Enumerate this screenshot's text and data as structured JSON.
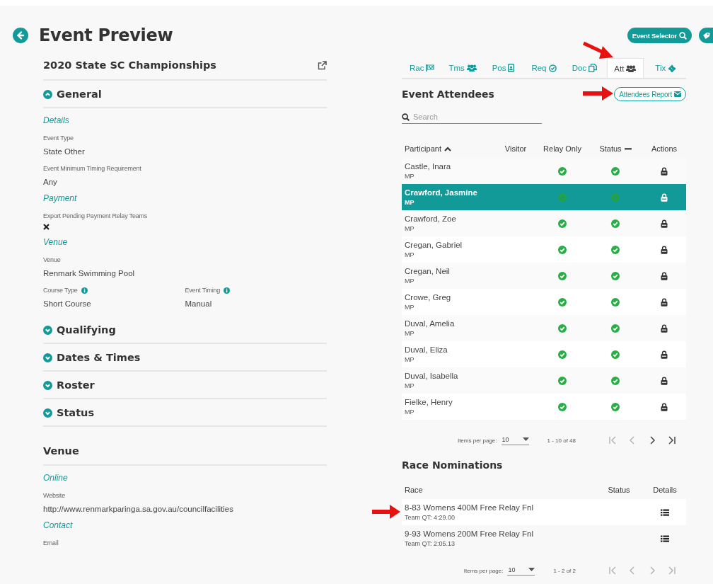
{
  "header": {
    "title": "Event Preview",
    "selector_button": "Event Selector"
  },
  "event": {
    "name": "2020 State SC Championships",
    "sections": [
      {
        "title": "General",
        "expanded": true,
        "groups": [
          {
            "heading": "Details",
            "rows": [
              [
                {
                  "kind": "text",
                  "label": "Event Type",
                  "value": "State Other",
                  "info": false
                }
              ],
              [
                {
                  "kind": "text",
                  "label": "Event Minimum Timing Requirement",
                  "value": "Any",
                  "info": false
                }
              ]
            ]
          },
          {
            "heading": "Payment",
            "rows": [
              [
                {
                  "kind": "boolean",
                  "label": "Export Pending Payment Relay Teams",
                  "value": false,
                  "info": false
                }
              ]
            ]
          },
          {
            "heading": "Venue",
            "rows": [
              [
                {
                  "kind": "text",
                  "label": "Venue",
                  "value": "Renmark Swimming Pool",
                  "info": false
                }
              ],
              [
                {
                  "kind": "text",
                  "label": "Course Type",
                  "value": "Short Course",
                  "info": true
                },
                {
                  "kind": "text",
                  "label": "Event Timing",
                  "value": "Manual",
                  "info": true
                }
              ]
            ]
          }
        ]
      },
      {
        "title": "Qualifying",
        "expanded": false
      },
      {
        "title": "Dates & Times",
        "expanded": false
      },
      {
        "title": "Roster",
        "expanded": false
      },
      {
        "title": "Status",
        "expanded": false
      }
    ],
    "venue": {
      "title": "Venue",
      "groups": [
        {
          "heading": "Online",
          "rows": [
            [
              {
                "kind": "text",
                "label": "Website",
                "value": "http://www.renmarkparinga.sa.gov.au/councilfacilities",
                "info": false
              }
            ]
          ]
        },
        {
          "heading": "Contact",
          "rows": [
            [
              {
                "kind": "text",
                "label": "Email",
                "info": false
              }
            ]
          ]
        }
      ]
    }
  },
  "tabs": [
    {
      "label": "Rac",
      "selected": false
    },
    {
      "label": "Tms",
      "selected": false
    },
    {
      "label": "Pos",
      "selected": false
    },
    {
      "label": "Req",
      "selected": false
    },
    {
      "label": "Doc",
      "selected": false
    },
    {
      "label": "Att",
      "selected": true
    },
    {
      "label": "Tix",
      "selected": false
    }
  ],
  "attendees": {
    "title": "Event Attendees",
    "report_button": "Attendees Report",
    "search": {
      "placeholder": "Search"
    },
    "columns": [
      {
        "label": "Participant",
        "sorted": true
      },
      {
        "label": "Visitor"
      },
      {
        "label": "Relay Only"
      },
      {
        "label": "Status",
        "sortable": true
      },
      {
        "label": "Actions"
      }
    ],
    "rows": [
      {
        "name": "Castle, Inara",
        "team": "MP",
        "visitor": false,
        "relay_only": true,
        "status": true,
        "selected": false
      },
      {
        "name": "Crawford, Jasmine",
        "team": "MP",
        "visitor": false,
        "relay_only": true,
        "status": true,
        "selected": true
      },
      {
        "name": "Crawford, Zoe",
        "team": "MP",
        "visitor": false,
        "relay_only": true,
        "status": true,
        "selected": false
      },
      {
        "name": "Cregan, Gabriel",
        "team": "MP",
        "visitor": false,
        "relay_only": true,
        "status": true,
        "selected": false
      },
      {
        "name": "Cregan, Neil",
        "team": "MP",
        "visitor": false,
        "relay_only": true,
        "status": true,
        "selected": false
      },
      {
        "name": "Crowe, Greg",
        "team": "MP",
        "visitor": false,
        "relay_only": true,
        "status": true,
        "selected": false
      },
      {
        "name": "Duval, Amelia",
        "team": "MP",
        "visitor": false,
        "relay_only": true,
        "status": true,
        "selected": false
      },
      {
        "name": "Duval, Eliza",
        "team": "MP",
        "visitor": false,
        "relay_only": true,
        "status": true,
        "selected": false
      },
      {
        "name": "Duval, Isabella",
        "team": "MP",
        "visitor": false,
        "relay_only": true,
        "status": true,
        "selected": false
      },
      {
        "name": "Fielke, Henry",
        "team": "MP",
        "visitor": false,
        "relay_only": true,
        "status": true,
        "selected": false
      }
    ],
    "pagination": {
      "label": "Items per page:",
      "per_page": "10",
      "range": "1 - 10 of 48",
      "nav": [
        {
          "disabled": true
        },
        {
          "disabled": true
        },
        {
          "disabled": false
        },
        {
          "disabled": false
        }
      ]
    }
  },
  "nominations": {
    "title": "Race Nominations",
    "columns": [
      {
        "label": "Race"
      },
      {
        "label": "Status"
      },
      {
        "label": "Details"
      }
    ],
    "rows": [
      {
        "race": "8-83 Womens 400M Free Relay Fnl",
        "qt": "Team QT: 4:29.00"
      },
      {
        "race": "9-93 Womens 200M Free Relay Fnl",
        "qt": "Team QT: 2:05.13"
      }
    ],
    "pagination": {
      "label": "Items per page:",
      "per_page": "10",
      "range": "1 - 2 of 2",
      "nav": [
        {
          "disabled": true
        },
        {
          "disabled": true
        },
        {
          "disabled": true
        },
        {
          "disabled": true
        }
      ]
    }
  }
}
